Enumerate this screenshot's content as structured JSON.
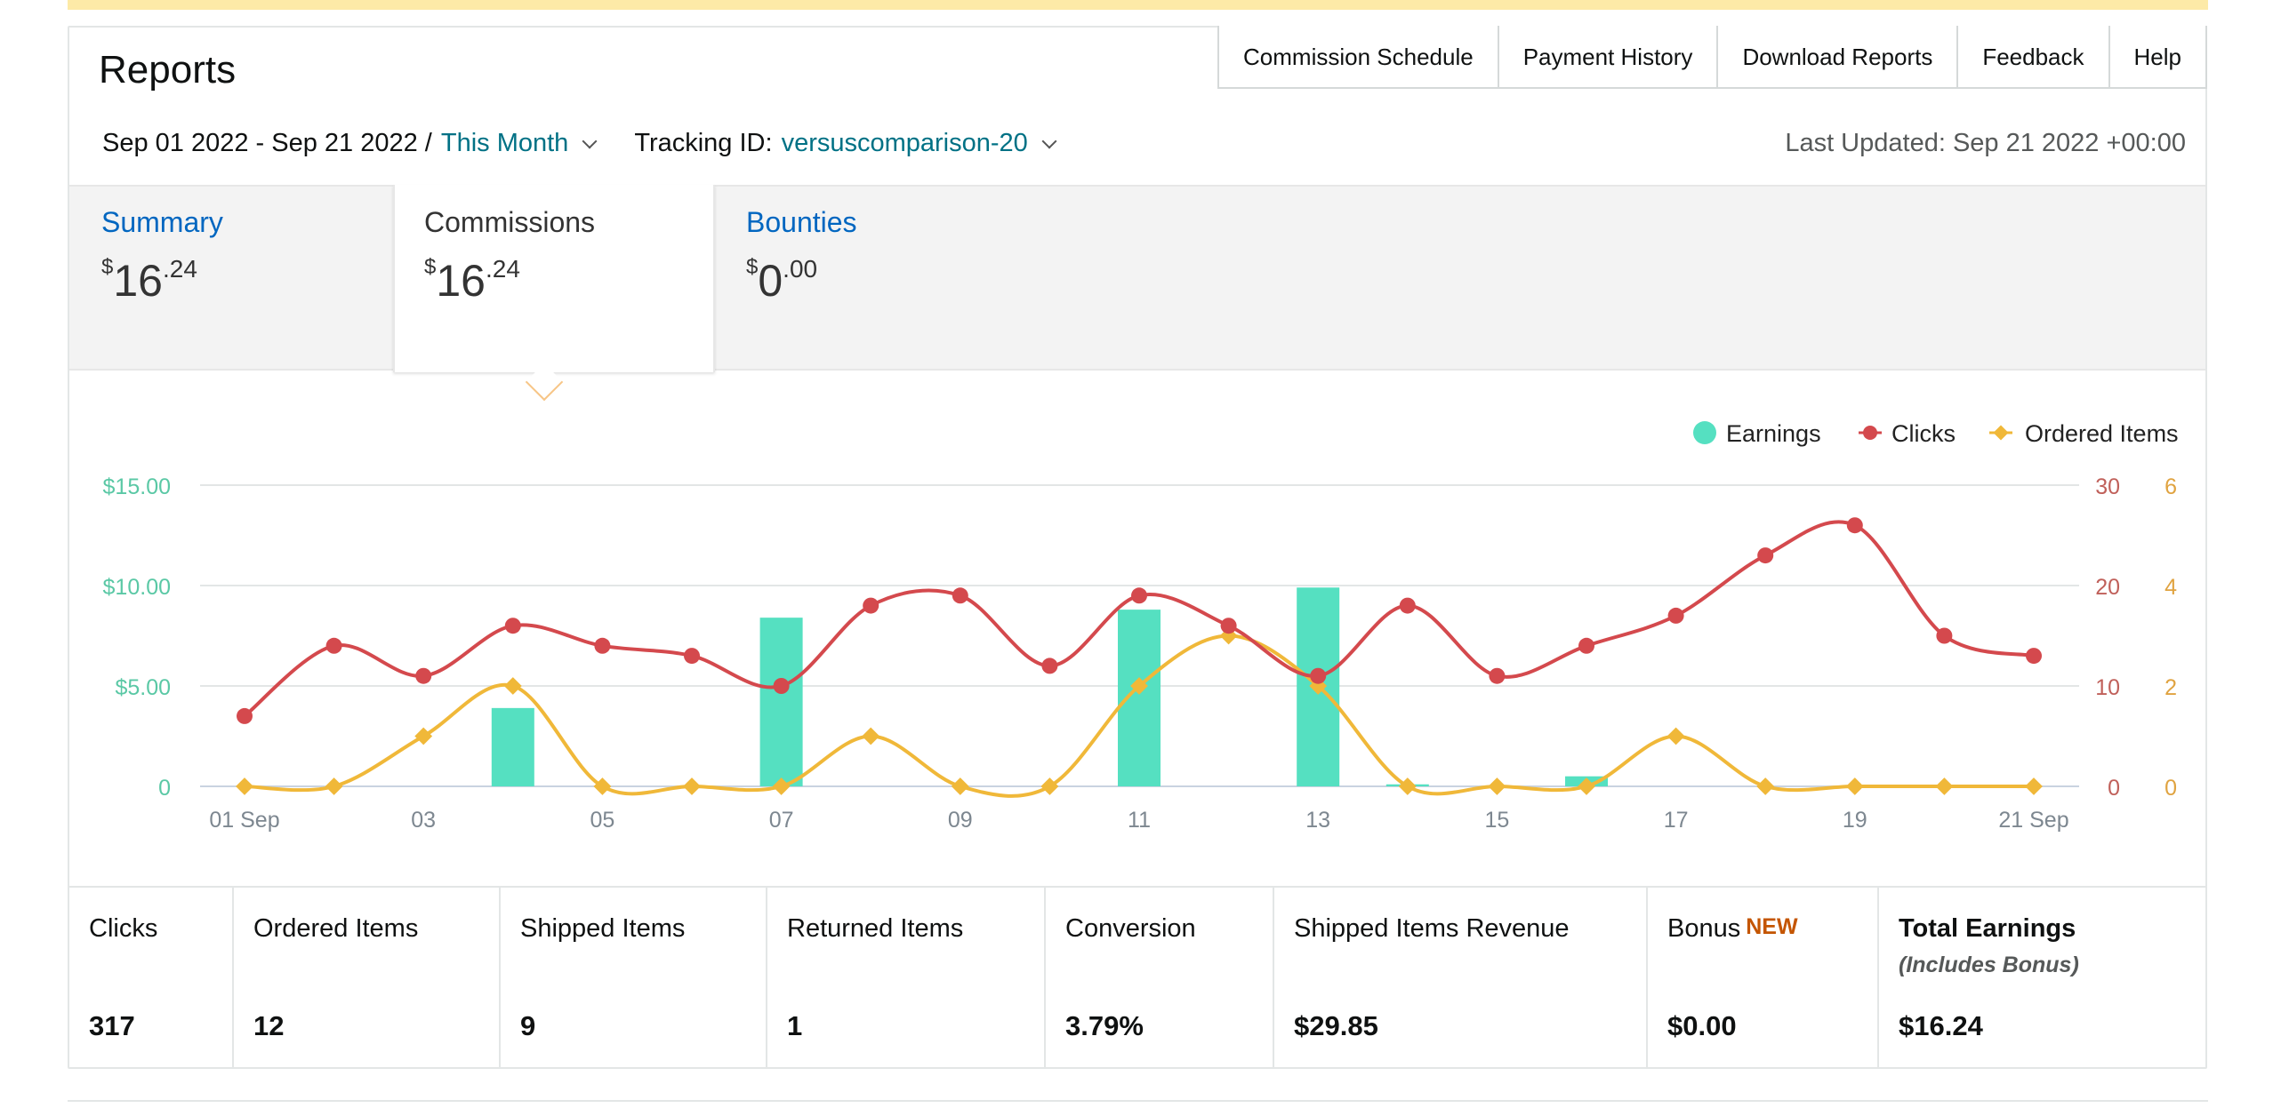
{
  "page": {
    "title": "Reports",
    "top_links": [
      "Commission Schedule",
      "Payment History",
      "Download Reports",
      "Feedback",
      "Help"
    ],
    "date_range": "Sep 01 2022 - Sep 21 2022 /",
    "date_preset": "This Month",
    "tracking_label": "Tracking ID:",
    "tracking_id": "versuscomparison-20",
    "last_updated": "Last Updated: Sep 21 2022 +00:00"
  },
  "tabs": [
    {
      "label": "Summary",
      "currency": "$",
      "whole": "16",
      "cents": ".24"
    },
    {
      "label": "Commissions",
      "currency": "$",
      "whole": "16",
      "cents": ".24"
    },
    {
      "label": "Bounties",
      "currency": "$",
      "whole": "0",
      "cents": ".00"
    }
  ],
  "colors": {
    "earnings": "#55e0c1",
    "clicks": "#d4494d",
    "ordered_items": "#f0b839",
    "link": "#007185",
    "tab_link": "#0066c0",
    "new_badge": "#c45500"
  },
  "chart_data": {
    "type": "bar+line",
    "x_labels": [
      "01 Sep",
      "03",
      "05",
      "07",
      "09",
      "11",
      "13",
      "15",
      "17",
      "19",
      "21 Sep"
    ],
    "x": [
      1,
      2,
      3,
      4,
      5,
      6,
      7,
      8,
      9,
      10,
      11,
      12,
      13,
      14,
      15,
      16,
      17,
      18,
      19,
      20,
      21
    ],
    "legend": [
      "Earnings",
      "Clicks",
      "Ordered Items"
    ],
    "legend_position": "top-right",
    "y_left_ticks": [
      "$15.00",
      "$10.00",
      "$5.00",
      "0"
    ],
    "y_left_range": [
      0,
      15
    ],
    "y_right1_ticks": [
      "30",
      "20",
      "10",
      "0"
    ],
    "y_right1_range": [
      0,
      30
    ],
    "y_right2_ticks": [
      "6",
      "4",
      "2",
      "0"
    ],
    "y_right2_range": [
      0,
      6
    ],
    "series": [
      {
        "name": "Earnings",
        "kind": "bar",
        "axis": "left",
        "values": [
          0,
          0,
          0,
          3.9,
          0,
          0,
          8.4,
          0,
          0,
          0,
          8.8,
          0,
          9.9,
          0.1,
          0,
          0.5,
          0,
          0,
          0,
          0,
          0
        ]
      },
      {
        "name": "Clicks",
        "kind": "line",
        "axis": "right1",
        "values": [
          7,
          14,
          11,
          16,
          14,
          13,
          10,
          18,
          19,
          12,
          19,
          16,
          11,
          18,
          11,
          14,
          17,
          23,
          26,
          15,
          13
        ]
      },
      {
        "name": "Ordered Items",
        "kind": "line",
        "axis": "right2",
        "values": [
          0,
          0,
          1,
          2,
          0,
          0,
          0,
          1,
          0,
          0,
          2,
          3,
          2,
          0,
          0,
          0,
          1,
          0,
          0,
          0,
          0
        ]
      }
    ]
  },
  "stats": [
    {
      "label": "Clicks",
      "value": "317"
    },
    {
      "label": "Ordered Items",
      "value": "12"
    },
    {
      "label": "Shipped Items",
      "value": "9"
    },
    {
      "label": "Returned Items",
      "value": "1"
    },
    {
      "label": "Conversion",
      "value": "3.79%"
    },
    {
      "label": "Shipped Items Revenue",
      "value": "$29.85"
    },
    {
      "label": "Bonus",
      "badge": "NEW",
      "value": "$0.00"
    },
    {
      "label": "Total Earnings",
      "sublabel": "(Includes Bonus)",
      "value": "$16.24"
    }
  ]
}
